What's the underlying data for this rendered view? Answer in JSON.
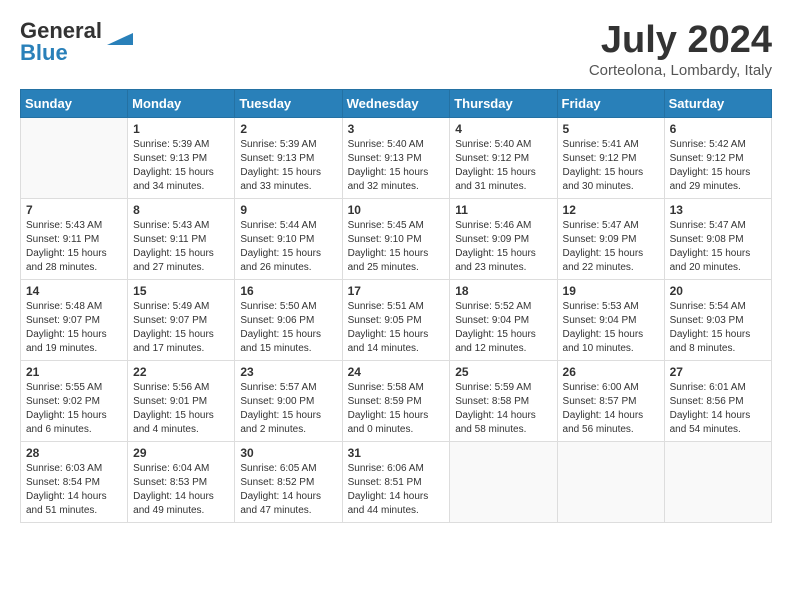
{
  "header": {
    "logo_general": "General",
    "logo_blue": "Blue",
    "month_title": "July 2024",
    "location": "Corteolona, Lombardy, Italy"
  },
  "calendar": {
    "days_of_week": [
      "Sunday",
      "Monday",
      "Tuesday",
      "Wednesday",
      "Thursday",
      "Friday",
      "Saturday"
    ],
    "weeks": [
      [
        {
          "day": "",
          "info": ""
        },
        {
          "day": "1",
          "info": "Sunrise: 5:39 AM\nSunset: 9:13 PM\nDaylight: 15 hours\nand 34 minutes."
        },
        {
          "day": "2",
          "info": "Sunrise: 5:39 AM\nSunset: 9:13 PM\nDaylight: 15 hours\nand 33 minutes."
        },
        {
          "day": "3",
          "info": "Sunrise: 5:40 AM\nSunset: 9:13 PM\nDaylight: 15 hours\nand 32 minutes."
        },
        {
          "day": "4",
          "info": "Sunrise: 5:40 AM\nSunset: 9:12 PM\nDaylight: 15 hours\nand 31 minutes."
        },
        {
          "day": "5",
          "info": "Sunrise: 5:41 AM\nSunset: 9:12 PM\nDaylight: 15 hours\nand 30 minutes."
        },
        {
          "day": "6",
          "info": "Sunrise: 5:42 AM\nSunset: 9:12 PM\nDaylight: 15 hours\nand 29 minutes."
        }
      ],
      [
        {
          "day": "7",
          "info": "Sunrise: 5:43 AM\nSunset: 9:11 PM\nDaylight: 15 hours\nand 28 minutes."
        },
        {
          "day": "8",
          "info": "Sunrise: 5:43 AM\nSunset: 9:11 PM\nDaylight: 15 hours\nand 27 minutes."
        },
        {
          "day": "9",
          "info": "Sunrise: 5:44 AM\nSunset: 9:10 PM\nDaylight: 15 hours\nand 26 minutes."
        },
        {
          "day": "10",
          "info": "Sunrise: 5:45 AM\nSunset: 9:10 PM\nDaylight: 15 hours\nand 25 minutes."
        },
        {
          "day": "11",
          "info": "Sunrise: 5:46 AM\nSunset: 9:09 PM\nDaylight: 15 hours\nand 23 minutes."
        },
        {
          "day": "12",
          "info": "Sunrise: 5:47 AM\nSunset: 9:09 PM\nDaylight: 15 hours\nand 22 minutes."
        },
        {
          "day": "13",
          "info": "Sunrise: 5:47 AM\nSunset: 9:08 PM\nDaylight: 15 hours\nand 20 minutes."
        }
      ],
      [
        {
          "day": "14",
          "info": "Sunrise: 5:48 AM\nSunset: 9:07 PM\nDaylight: 15 hours\nand 19 minutes."
        },
        {
          "day": "15",
          "info": "Sunrise: 5:49 AM\nSunset: 9:07 PM\nDaylight: 15 hours\nand 17 minutes."
        },
        {
          "day": "16",
          "info": "Sunrise: 5:50 AM\nSunset: 9:06 PM\nDaylight: 15 hours\nand 15 minutes."
        },
        {
          "day": "17",
          "info": "Sunrise: 5:51 AM\nSunset: 9:05 PM\nDaylight: 15 hours\nand 14 minutes."
        },
        {
          "day": "18",
          "info": "Sunrise: 5:52 AM\nSunset: 9:04 PM\nDaylight: 15 hours\nand 12 minutes."
        },
        {
          "day": "19",
          "info": "Sunrise: 5:53 AM\nSunset: 9:04 PM\nDaylight: 15 hours\nand 10 minutes."
        },
        {
          "day": "20",
          "info": "Sunrise: 5:54 AM\nSunset: 9:03 PM\nDaylight: 15 hours\nand 8 minutes."
        }
      ],
      [
        {
          "day": "21",
          "info": "Sunrise: 5:55 AM\nSunset: 9:02 PM\nDaylight: 15 hours\nand 6 minutes."
        },
        {
          "day": "22",
          "info": "Sunrise: 5:56 AM\nSunset: 9:01 PM\nDaylight: 15 hours\nand 4 minutes."
        },
        {
          "day": "23",
          "info": "Sunrise: 5:57 AM\nSunset: 9:00 PM\nDaylight: 15 hours\nand 2 minutes."
        },
        {
          "day": "24",
          "info": "Sunrise: 5:58 AM\nSunset: 8:59 PM\nDaylight: 15 hours\nand 0 minutes."
        },
        {
          "day": "25",
          "info": "Sunrise: 5:59 AM\nSunset: 8:58 PM\nDaylight: 14 hours\nand 58 minutes."
        },
        {
          "day": "26",
          "info": "Sunrise: 6:00 AM\nSunset: 8:57 PM\nDaylight: 14 hours\nand 56 minutes."
        },
        {
          "day": "27",
          "info": "Sunrise: 6:01 AM\nSunset: 8:56 PM\nDaylight: 14 hours\nand 54 minutes."
        }
      ],
      [
        {
          "day": "28",
          "info": "Sunrise: 6:03 AM\nSunset: 8:54 PM\nDaylight: 14 hours\nand 51 minutes."
        },
        {
          "day": "29",
          "info": "Sunrise: 6:04 AM\nSunset: 8:53 PM\nDaylight: 14 hours\nand 49 minutes."
        },
        {
          "day": "30",
          "info": "Sunrise: 6:05 AM\nSunset: 8:52 PM\nDaylight: 14 hours\nand 47 minutes."
        },
        {
          "day": "31",
          "info": "Sunrise: 6:06 AM\nSunset: 8:51 PM\nDaylight: 14 hours\nand 44 minutes."
        },
        {
          "day": "",
          "info": ""
        },
        {
          "day": "",
          "info": ""
        },
        {
          "day": "",
          "info": ""
        }
      ]
    ]
  }
}
